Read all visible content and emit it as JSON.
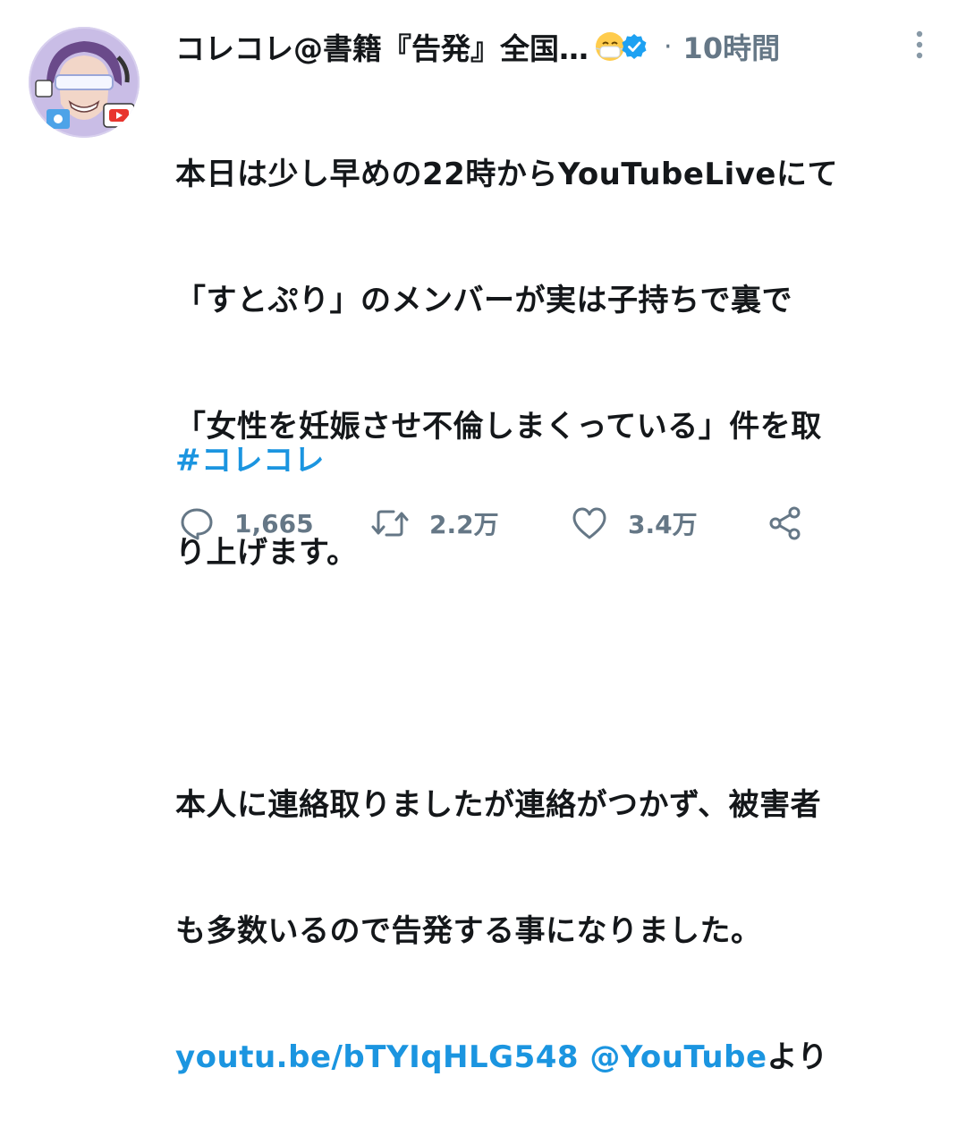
{
  "tweet": {
    "display_name": "コレコレ@書籍『告発』全国…",
    "timestamp": "10時間",
    "body": {
      "line1": "本日は少し早めの22時からYouTubeLiveにて",
      "line2": "「すとぷり」のメンバーが実は子持ちで裏で",
      "line3": "「女性を妊娠させ不倫しまくっている」件を取",
      "line4": "り上げます。",
      "line5": "本人に連絡取りましたが連絡がつかず、被害者",
      "line6": "も多数いるので告発する事になりました。",
      "link1": "youtu.be/bTYIqHLG548",
      "link2": "@YouTube",
      "link_suffix": "より"
    },
    "hashtag": "#コレコレ",
    "counts": {
      "replies": "1,665",
      "retweets": "2.2万",
      "likes": "3.4万"
    },
    "icons": {
      "emoji": "mask-face-emoji",
      "verified": "verified-badge-icon",
      "more": "more-vertical-icon",
      "reply": "reply-icon",
      "retweet": "retweet-icon",
      "like": "heart-icon",
      "share": "share-icon"
    },
    "colors": {
      "link": "#1b95e0",
      "muted": "#657786",
      "text": "#14171a"
    }
  }
}
